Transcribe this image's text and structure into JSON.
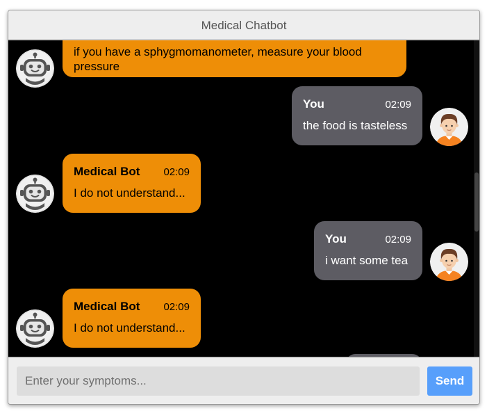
{
  "header": {
    "title": "Medical Chatbot"
  },
  "messages": [
    {
      "sender": "",
      "time": "",
      "text": "if you have a sphygmomanometer, measure your blood pressure",
      "role": "bot"
    },
    {
      "sender": "You",
      "time": "02:09",
      "text": "the food is tasteless",
      "role": "user"
    },
    {
      "sender": "Medical Bot",
      "time": "02:09",
      "text": "I do not understand...",
      "role": "bot"
    },
    {
      "sender": "You",
      "time": "02:09",
      "text": "i want some tea",
      "role": "user"
    },
    {
      "sender": "Medical Bot",
      "time": "02:09",
      "text": "I do not understand...",
      "role": "bot"
    }
  ],
  "composer": {
    "placeholder": "Enter your symptoms...",
    "send_label": "Send"
  },
  "colors": {
    "bot_bubble": "#ee8e07",
    "user_bubble": "#5d5c63",
    "chat_bg": "#000000",
    "send_button": "#579ffb"
  },
  "icons": {
    "bot_avatar": "robot-avatar-icon",
    "user_avatar": "person-avatar-icon"
  }
}
